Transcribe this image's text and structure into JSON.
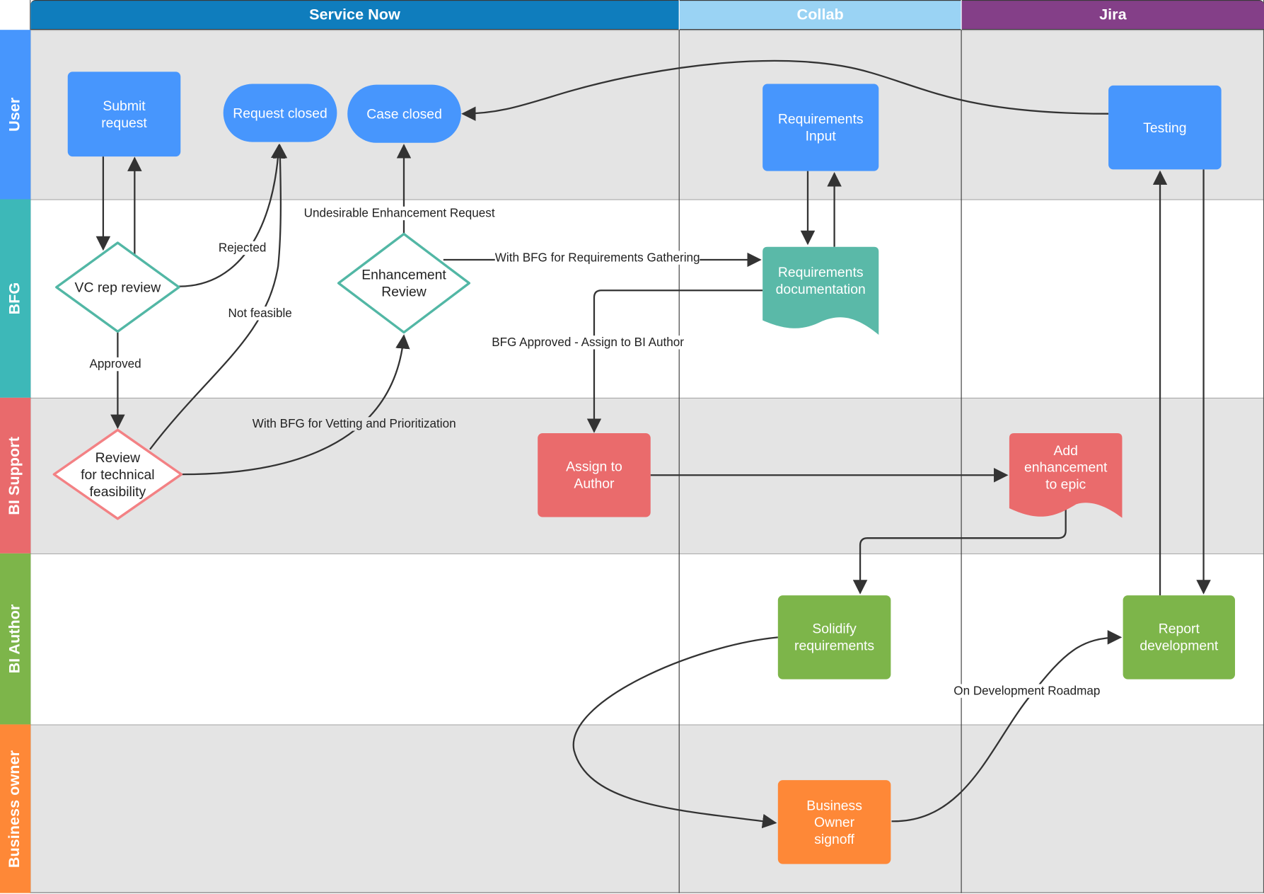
{
  "columns": [
    {
      "label": "Service Now",
      "color": "#0f7dbd"
    },
    {
      "label": "Collab",
      "color": "#9ad3f4"
    },
    {
      "label": "Jira",
      "color": "#843f88"
    }
  ],
  "lanes": [
    {
      "label": "User",
      "color": "#4796fd"
    },
    {
      "label": "BFG",
      "color": "#3db8b8"
    },
    {
      "label": "BI Support",
      "color": "#e96a6c"
    },
    {
      "label": "BI Author",
      "color": "#7db54a"
    },
    {
      "label": "Business owner",
      "color": "#fe8837"
    }
  ],
  "nodes": {
    "submit_request": "Submit\nrequest",
    "request_closed": "Request closed",
    "case_closed": "Case closed",
    "requirements_input": "Requirements\nInput",
    "testing": "Testing",
    "vc_rep_review": "VC rep review",
    "enhancement_review": "Enhancement\nReview",
    "requirements_documentation": "Requirements\ndocumentation",
    "review_technical_feasibility": "Review\nfor technical\nfeasibility",
    "assign_to_author": "Assign to\nAuthor",
    "add_enhancement_to_epic": "Add\nenhancement\nto epic",
    "solidify_requirements": "Solidify\nrequirements",
    "report_development": "Report\ndevelopment",
    "business_owner_signoff": "Business\nOwner\nsignoff"
  },
  "edge_labels": {
    "rejected": "Rejected",
    "not_feasible": "Not feasible",
    "approved": "Approved",
    "undesirable": "Undesirable Enhancement Request",
    "with_bfg_requirements": "With BFG for Requirements Gathering",
    "bfg_approved": "BFG Approved - Assign to BI Author",
    "with_bfg_vetting": "With BFG for Vetting and Prioritization",
    "on_dev_roadmap": "On Development Roadmap"
  },
  "colors": {
    "user_node": "#4796fd",
    "bfg_node": "#5ab9a8",
    "bfg_diamond_stroke": "#52b7a5",
    "bi_support_node": "#ea6b6c",
    "bi_author_node": "#7db54a",
    "business_owner_node": "#fe8837",
    "lane_shade": "#e4e4e4"
  }
}
